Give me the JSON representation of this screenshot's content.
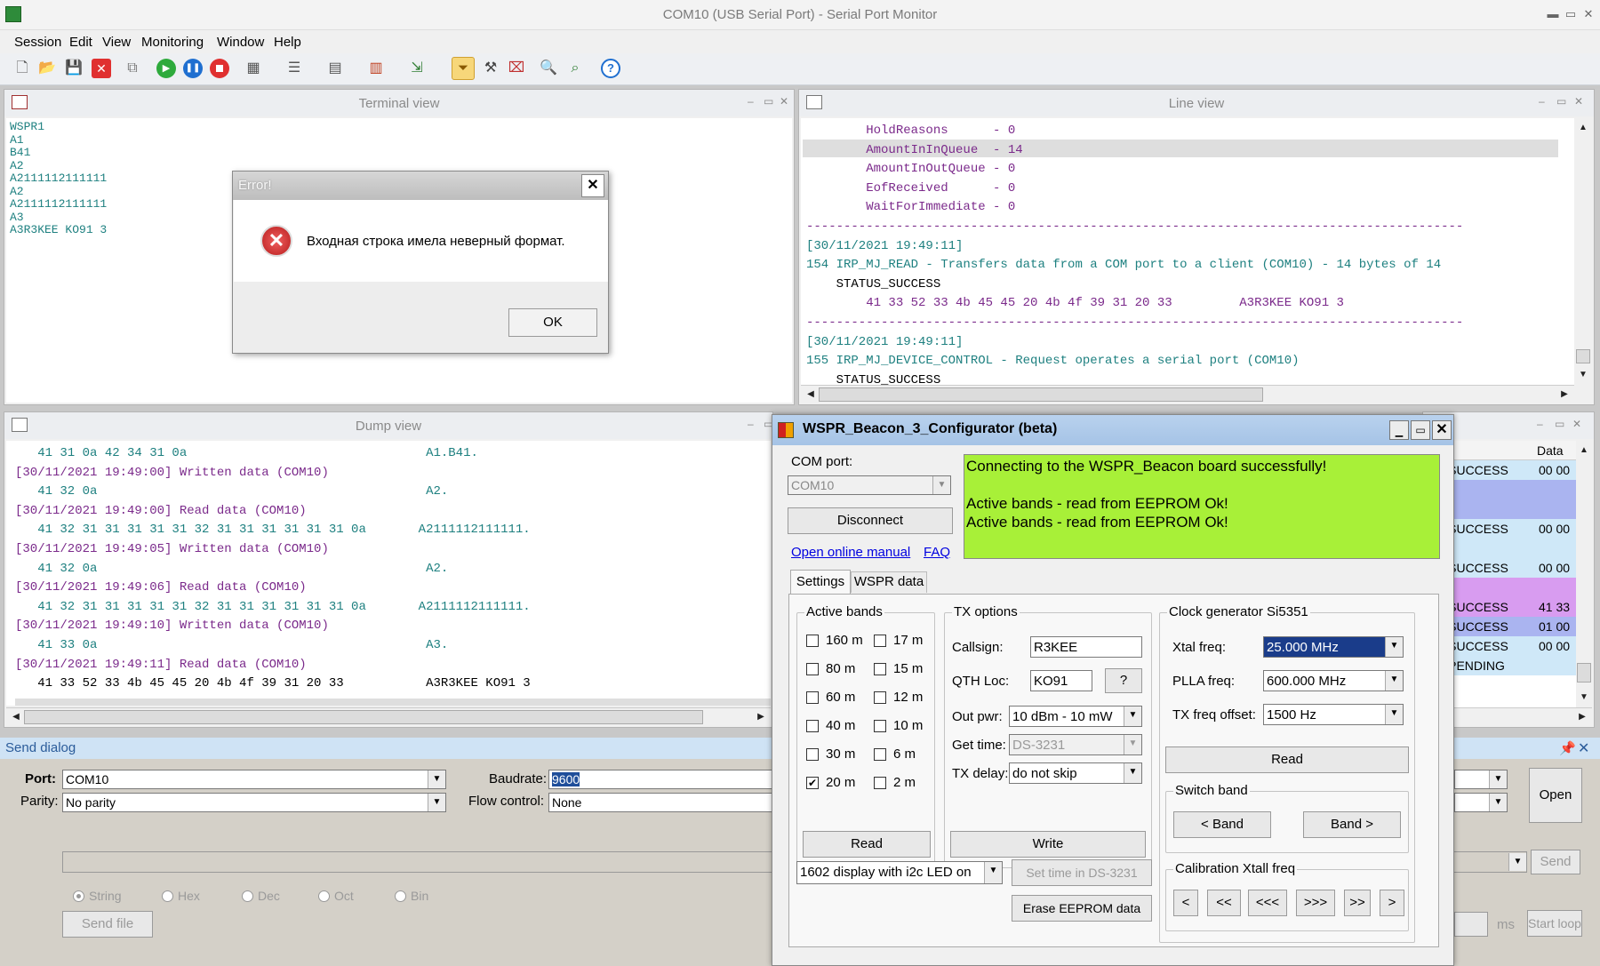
{
  "window": {
    "title": "COM10 (USB Serial Port) - Serial Port Monitor"
  },
  "menu": [
    "Session",
    "Edit",
    "View",
    "Monitoring",
    "Window",
    "Help"
  ],
  "terminal": {
    "title": "Terminal view",
    "lines": [
      "WSPR1",
      "A1",
      "B41",
      "A2",
      "A2111112111111",
      "A2",
      "A2111112111111",
      "A3",
      "A3R3KEE KO91 3"
    ]
  },
  "error": {
    "title": "Error!",
    "message": "Входная строка имела неверный формат.",
    "ok": "OK"
  },
  "lineview": {
    "title": "Line view",
    "lines": [
      "        HoldReasons      - 0",
      "        AmountInInQueue  - 14",
      "        AmountInOutQueue - 0",
      "        EofReceived      - 0",
      "        WaitForImmediate - 0",
      "----------------------------------------------------------------------------------------",
      "[30/11/2021 19:49:11]",
      "154 IRP_MJ_READ - Transfers data from a COM port to a client (COM10) - 14 bytes of 14",
      "    STATUS_SUCCESS",
      "        41 33 52 33 4b 45 45 20 4b 4f 39 31 20 33         A3R3KEE KO91 3",
      "----------------------------------------------------------------------------------------",
      "[30/11/2021 19:49:11]",
      "155 IRP_MJ_DEVICE_CONTROL - Request operates a serial port (COM10)",
      "    STATUS_SUCCESS"
    ]
  },
  "dump": {
    "title": "Dump view",
    "lines": [
      "   41 31 0a 42 34 31 0a                                A1.B41.",
      "[30/11/2021 19:49:00] Written data (COM10)",
      "   41 32 0a                                            A2.",
      "[30/11/2021 19:49:00] Read data (COM10)",
      "   41 32 31 31 31 31 31 32 31 31 31 31 31 31 0a       A2111112111111.",
      "[30/11/2021 19:49:05] Written data (COM10)",
      "   41 32 0a                                            A2.",
      "[30/11/2021 19:49:06] Read data (COM10)",
      "   41 32 31 31 31 31 31 32 31 31 31 31 31 31 0a       A2111112111111.",
      "[30/11/2021 19:49:10] Written data (COM10)",
      "   41 33 0a                                            A3.",
      "[30/11/2021 19:49:11] Read data (COM10)",
      "   41 33 52 33 4b 45 45 20 4b 4f 39 31 20 33           A3R3KEE KO91 3"
    ]
  },
  "requestview": {
    "col_data": "Data",
    "rows": [
      {
        "status": "JS_SUCCESS",
        "data": "00 00",
        "bg": "#cfe8f8"
      },
      {
        "status": "",
        "data": "",
        "bg": "#aab4f0"
      },
      {
        "status": "JS_SUCCESS",
        "data": "00 00",
        "bg": "#cfe8f8"
      },
      {
        "status": "JS_SUCCESS",
        "data": "00 00",
        "bg": "#cfe8f8"
      },
      {
        "status": "",
        "data": "",
        "bg": "#d89cf0"
      },
      {
        "status": "JS_SUCCESS",
        "data": "41 33",
        "bg": "#d89cf0"
      },
      {
        "status": "JS_SUCCESS",
        "data": "01 00",
        "bg": "#aab4f0"
      },
      {
        "status": "JS_SUCCESS",
        "data": "00 00",
        "bg": "#cfe8f8"
      },
      {
        "status": "JS_PENDING",
        "data": "",
        "bg": "#cfe8f8"
      }
    ]
  },
  "send": {
    "title": "Send dialog",
    "port_label": "Port:",
    "port_value": "COM10",
    "parity_label": "Parity:",
    "parity_value": "No parity",
    "baud_label": "Baudrate:",
    "baud_value": "9600",
    "flow_label": "Flow control:",
    "flow_value": "None",
    "open": "Open",
    "send": "Send",
    "formats": [
      "String",
      "Hex",
      "Dec",
      "Oct",
      "Bin"
    ],
    "send_file": "Send file",
    "ms": "ms",
    "start_loop": "Start loop"
  },
  "cfg": {
    "title": "WSPR_Beacon_3_Configurator (beta)",
    "com_label": "COM port:",
    "com_value": "COM10",
    "disconnect": "Disconnect",
    "manual": "Open online manual",
    "faq": "FAQ",
    "status_lines": [
      "Connecting to the WSPR_Beacon board successfully!",
      "",
      "Active bands - read from EEPROM Ok!",
      "Active bands - read from EEPROM Ok!"
    ],
    "tabs": [
      "Settings",
      "WSPR data"
    ],
    "active_bands_title": "Active bands",
    "bands": [
      {
        "label": "160 m",
        "checked": false
      },
      {
        "label": "17 m",
        "checked": false
      },
      {
        "label": "80 m",
        "checked": false
      },
      {
        "label": "15 m",
        "checked": false
      },
      {
        "label": "60 m",
        "checked": false
      },
      {
        "label": "12 m",
        "checked": false
      },
      {
        "label": "40 m",
        "checked": false
      },
      {
        "label": "10 m",
        "checked": false
      },
      {
        "label": "30 m",
        "checked": false
      },
      {
        "label": "6 m",
        "checked": false
      },
      {
        "label": "20 m",
        "checked": true
      },
      {
        "label": "2 m",
        "checked": false
      }
    ],
    "bands_read": "Read",
    "tx_title": "TX options",
    "callsign_label": "Callsign:",
    "callsign": "R3KEE",
    "qth_label": "QTH Loc:",
    "qth": "KO91",
    "qth_help": "?",
    "outpwr_label": "Out pwr:",
    "outpwr": "10 dBm - 10 mW",
    "gettime_label": "Get time:",
    "gettime": "DS-3231",
    "txdelay_label": "TX delay:",
    "txdelay": "do not skip",
    "write": "Write",
    "clock_title": "Clock generator Si5351",
    "xtal_label": "Xtal freq:",
    "xtal": "25.000 MHz",
    "plla_label": "PLLA freq:",
    "plla": "600.000 MHz",
    "txoff_label": "TX freq offset:",
    "txoff": "1500 Hz",
    "clock_read": "Read",
    "switch_title": "Switch band",
    "band_prev": "< Band",
    "band_next": "Band >",
    "calib_title": "Calibration Xtall freq",
    "calib": [
      "<",
      "<<",
      "<<<",
      ">>>",
      ">>",
      ">"
    ],
    "display": "1602 display with i2c LED on",
    "set_time": "Set time in DS-3231",
    "erase": "Erase EEPROM data"
  }
}
